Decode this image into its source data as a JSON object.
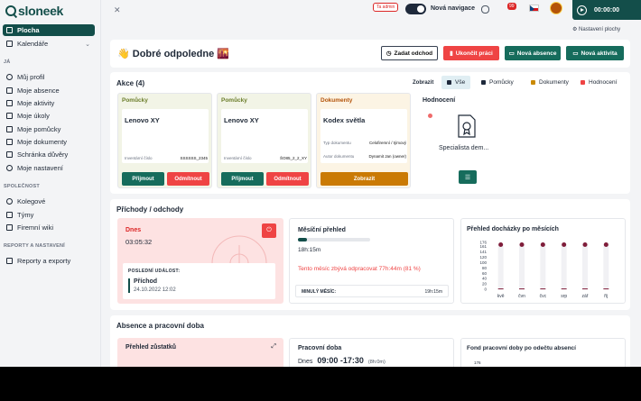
{
  "logo": "sloneek",
  "sidebar": {
    "main": [
      {
        "label": "Plocha",
        "active": true
      },
      {
        "label": "Kalendáře",
        "active": false
      }
    ],
    "section_ja": "JÁ",
    "ja": [
      "Můj profil",
      "Moje absence",
      "Moje aktivity",
      "Moje úkoly",
      "Moje pomůcky",
      "Moje dokumenty",
      "Schránka důvěry",
      "Moje nastavení"
    ],
    "section_company": "SPOLEČNOST",
    "company": [
      "Kolegové",
      "Týmy",
      "Firemní wiki"
    ],
    "section_reports": "REPORTY A NASTAVENÍ",
    "reports": [
      "Reporty a exporty"
    ]
  },
  "topbar": {
    "admin_badge": "Ta admin",
    "nav_toggle_label": "Nová navigace",
    "notif_count": "99",
    "timer": "00:00:00",
    "settings_link": "Nastavení plochy"
  },
  "greeting": {
    "title": "👋 Dobré odpoledne 🌇",
    "buttons": {
      "leave": "Zadat odchod",
      "end_work": "Ukončit práci",
      "new_absence": "Nová absence",
      "new_activity": "Nová aktivita"
    }
  },
  "actions": {
    "title": "Akce (4)",
    "filter_label": "Zobrazit",
    "filters": [
      {
        "label": "Vše",
        "color": "#1e293b"
      },
      {
        "label": "Pomůcky",
        "color": "#1e293b"
      },
      {
        "label": "Dokumenty",
        "color": "#ca8a04"
      },
      {
        "label": "Hodnocení",
        "color": "#ef4444"
      }
    ],
    "cards": [
      {
        "category": "Pomůcky",
        "name": "Lenovo XY",
        "key": "Inventární číslo",
        "value": "SSSSSS_2345",
        "accept": "Přijmout",
        "reject": "Odmítnout"
      },
      {
        "category": "Pomůcky",
        "name": "Lenovo XY",
        "key": "Inventární číslo",
        "value": "ŠO85_2_2_XY",
        "accept": "Přijmout",
        "reject": "Odmítnout"
      },
      {
        "category": "Dokumenty",
        "name": "Kodex světla",
        "rows": [
          {
            "key": "Typ dokumentu",
            "value": "Celofiremní / týmový"
          },
          {
            "key": "Autor dokumentu",
            "value": "Dynamit Jan (owner)"
          }
        ],
        "show": "Zobrazit"
      }
    ],
    "evaluation": {
      "title": "Hodnocení",
      "label": "Specialista dem..."
    }
  },
  "attendance": {
    "title": "Příchody / odchody",
    "today": {
      "label": "Dnes",
      "time": "03:05:32",
      "last_event_label": "POSLEDNÍ UDÁLOST:",
      "event_name": "Příchod",
      "event_time": "24.10.2022 12:02"
    },
    "month": {
      "title": "Měsíční přehled",
      "progress": 0.12,
      "hours": "18h:15m",
      "remaining": "Tento měsíc zbývá odpracovat 77h:44m (81 %)",
      "prev_label": "MINULÝ MĚSÍC:",
      "prev_value": "19h:15m"
    },
    "overview_title": "Přehled docházky po měsících"
  },
  "chart_data": {
    "type": "bar",
    "title": "Přehled docházky po měsících",
    "categories": [
      "kvě",
      "čvn",
      "čvc",
      "srp",
      "zář",
      "říj"
    ],
    "values": [
      3,
      3,
      3,
      3,
      3,
      3
    ],
    "ylim": [
      0,
      176
    ],
    "yticks": [
      0,
      20,
      40,
      60,
      80,
      100,
      120,
      141,
      161,
      176
    ]
  },
  "absence": {
    "title": "Absence a pracovní doba",
    "balance_title": "Přehled zůstatků",
    "worktime_title": "Pracovní doba",
    "worktime_day": "Dnes",
    "worktime_range": "09:00 -17:30",
    "worktime_hours": "(8h:0m)",
    "fund_title": "Fond pracovní doby po odečtu absencí",
    "fund_tick": "176"
  }
}
